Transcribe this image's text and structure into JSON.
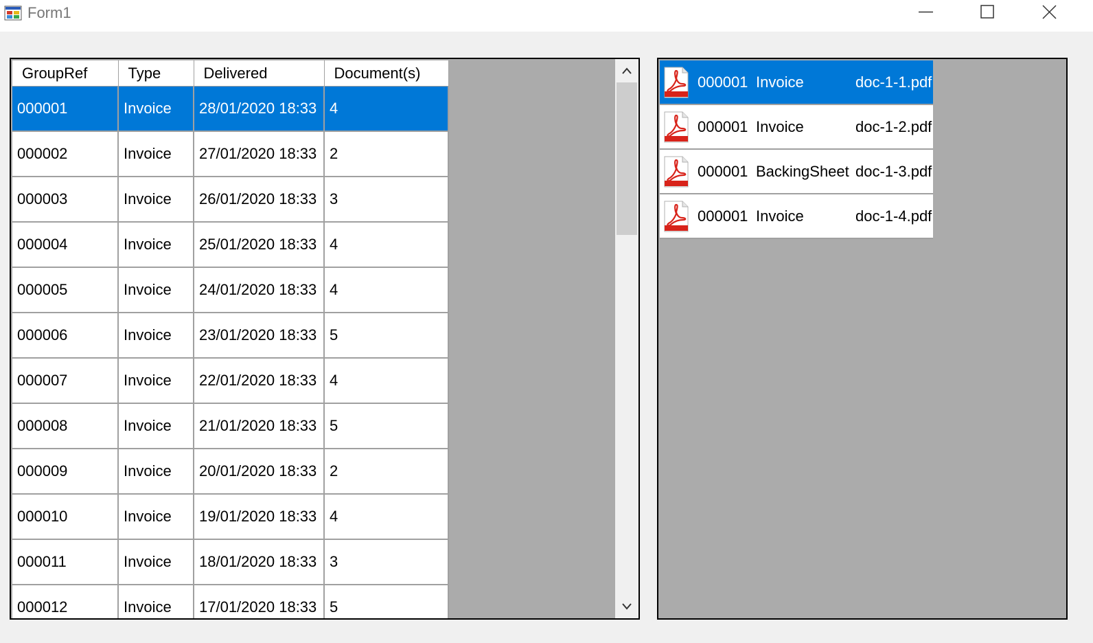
{
  "window": {
    "title": "Form1"
  },
  "grid": {
    "columns": [
      "GroupRef",
      "Type",
      "Delivered",
      "Document(s)"
    ],
    "rows": [
      [
        "000001",
        "Invoice",
        "28/01/2020 18:33",
        "4"
      ],
      [
        "000002",
        "Invoice",
        "27/01/2020 18:33",
        "2"
      ],
      [
        "000003",
        "Invoice",
        "26/01/2020 18:33",
        "3"
      ],
      [
        "000004",
        "Invoice",
        "25/01/2020 18:33",
        "4"
      ],
      [
        "000005",
        "Invoice",
        "24/01/2020 18:33",
        "4"
      ],
      [
        "000006",
        "Invoice",
        "23/01/2020 18:33",
        "5"
      ],
      [
        "000007",
        "Invoice",
        "22/01/2020 18:33",
        "4"
      ],
      [
        "000008",
        "Invoice",
        "21/01/2020 18:33",
        "5"
      ],
      [
        "000009",
        "Invoice",
        "20/01/2020 18:33",
        "2"
      ],
      [
        "000010",
        "Invoice",
        "19/01/2020 18:33",
        "4"
      ],
      [
        "000011",
        "Invoice",
        "18/01/2020 18:33",
        "3"
      ],
      [
        "000012",
        "Invoice",
        "17/01/2020 18:33",
        "5"
      ]
    ],
    "selected_row": 0
  },
  "documents": {
    "icon": "pdf-icon",
    "items": [
      {
        "ref": "000001",
        "type": "Invoice",
        "file": "doc-1-1.pdf"
      },
      {
        "ref": "000001",
        "type": "Invoice",
        "file": "doc-1-2.pdf"
      },
      {
        "ref": "000001",
        "type": "BackingSheet",
        "file": "doc-1-3.pdf"
      },
      {
        "ref": "000001",
        "type": "Invoice",
        "file": "doc-1-4.pdf"
      }
    ],
    "selected_item": 0
  },
  "colors": {
    "selection": "#0078d7",
    "panel_background": "#ababab",
    "form_background": "#f0f0f0"
  }
}
